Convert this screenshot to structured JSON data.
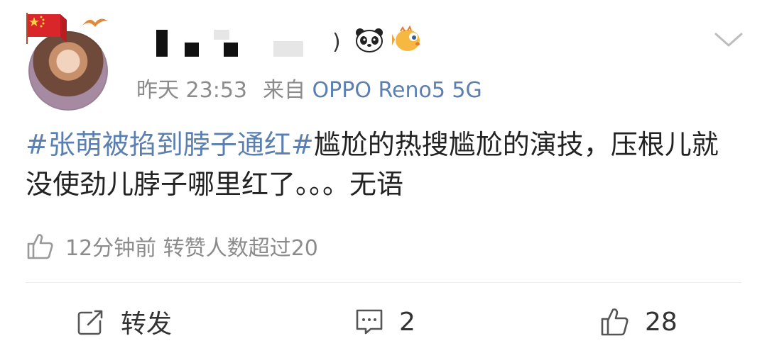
{
  "post": {
    "meta": {
      "time": "昨天 23:53",
      "source_prefix": "来自",
      "source": "OPPO Reno5 5G"
    },
    "content": {
      "hashtag": "#张萌被掐到脖子通红#",
      "text": "尴尬的热搜尴尬的演技，压根儿就没使劲儿脖子哪里红了。。。无语"
    },
    "like_notice": "12分钟前 转赞人数超过20",
    "username_suffix": ")"
  },
  "actions": {
    "repost_label": "转发",
    "comment_count": "2",
    "like_count": "28"
  },
  "icons": {
    "flag": "china-flag-icon",
    "panda": "panda-emoji-icon",
    "fish": "pufferfish-emoji-icon",
    "more": "chevron-down-icon",
    "thumb": "thumbs-up-icon",
    "repost": "repost-icon",
    "comment": "comment-icon"
  },
  "colors": {
    "link": "#5a7fb0",
    "meta": "#8b8b8b",
    "text": "#222222",
    "flag_red": "#d8262b",
    "flag_yellow": "#ffd23a"
  }
}
